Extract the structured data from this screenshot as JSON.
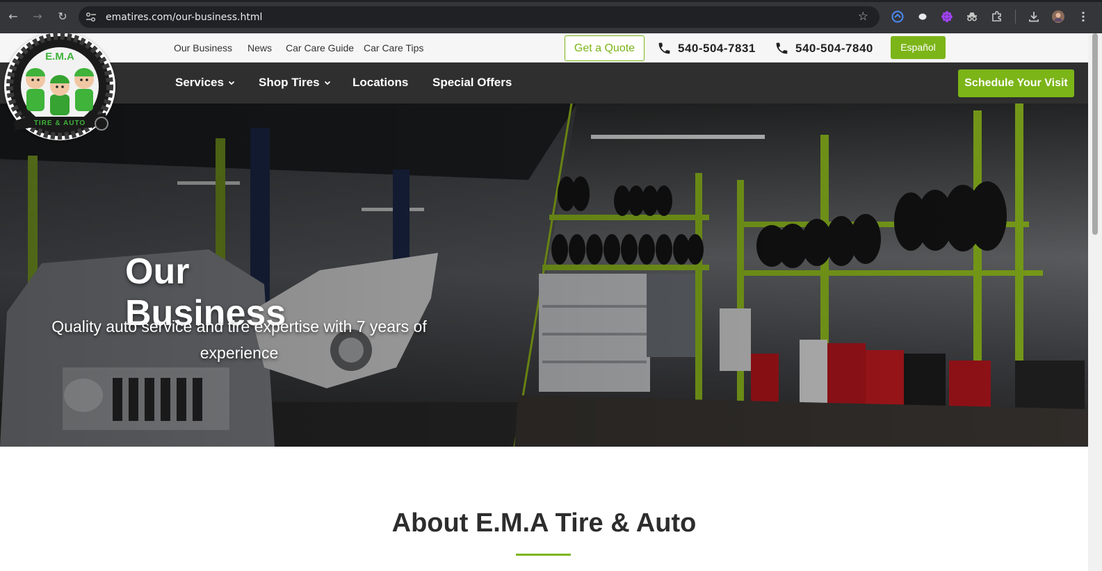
{
  "browser": {
    "url": "ematires.com/our-business.html",
    "back_icon": "arrow-left-icon",
    "forward_icon": "arrow-right-icon",
    "reload_icon": "reload-icon",
    "site_info_icon": "tune-icon",
    "bookmark_icon": "star-icon",
    "extensions": [
      "circle-extension-icon",
      "chat-bubble-icon",
      "flower-extension-icon",
      "incognito-extension-icon",
      "puzzle-icon",
      "download-icon",
      "avatar",
      "more-vert-icon"
    ]
  },
  "topbar": {
    "links": [
      "Our Business",
      "News",
      "Car Care Guide",
      "Car Care Tips"
    ],
    "quote_label": "Get a Quote",
    "phones": [
      "540-504-7831",
      "540-504-7840"
    ],
    "language_label": "Español"
  },
  "nav": {
    "items": [
      {
        "label": "Services",
        "has_dropdown": true
      },
      {
        "label": "Shop Tires",
        "has_dropdown": true
      },
      {
        "label": "Locations",
        "has_dropdown": false
      },
      {
        "label": "Special Offers",
        "has_dropdown": false
      }
    ],
    "cta_label": "Schedule Your Visit"
  },
  "logo": {
    "top_text": "E.M.A",
    "bottom_text": "TIRE & AUTO"
  },
  "hero": {
    "title": "Our Business",
    "subtitle": "Quality auto service and tire expertise with 7 years of experience"
  },
  "about": {
    "title": "About E.M.A Tire & Auto"
  },
  "colors": {
    "brand_green": "#7cb518",
    "nav_bg": "#2f2f2f",
    "topbar_bg": "#f6f6f6",
    "chrome_bg": "#35363a"
  }
}
